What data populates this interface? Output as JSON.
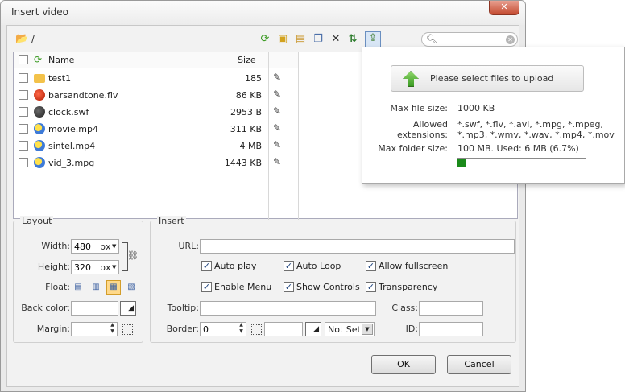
{
  "window": {
    "title": "Insert video",
    "close_label": "✕"
  },
  "toolbar": {
    "path": "/",
    "search": {
      "value": "",
      "placeholder": ""
    }
  },
  "files": {
    "header": {
      "name": "Name",
      "size": "Size"
    },
    "rows": [
      {
        "name": "test1",
        "size": "185",
        "type": "folder"
      },
      {
        "name": "barsandtone.flv",
        "size": "86 KB",
        "type": "flv"
      },
      {
        "name": "clock.swf",
        "size": "2953 B",
        "type": "swf"
      },
      {
        "name": "movie.mp4",
        "size": "311 KB",
        "type": "mp4"
      },
      {
        "name": "sintel.mp4",
        "size": "4 MB",
        "type": "mp4"
      },
      {
        "name": "vid_3.mpg",
        "size": "1443 KB",
        "type": "mpg"
      }
    ]
  },
  "layout": {
    "legend": "Layout",
    "width_label": "Width:",
    "width_value": "480",
    "width_unit": "px",
    "height_label": "Height:",
    "height_value": "320",
    "height_unit": "px",
    "float_label": "Float:",
    "backcolor_label": "Back color:",
    "backcolor_value": "",
    "margin_label": "Margin:",
    "margin_value": ""
  },
  "insert": {
    "legend": "Insert",
    "url_label": "URL:",
    "url_value": "",
    "checkboxes": {
      "auto_play": "Auto play",
      "auto_loop": "Auto Loop",
      "allow_fullscreen": "Allow fullscreen",
      "enable_menu": "Enable Menu",
      "show_controls": "Show Controls",
      "transparency": "Transparency"
    },
    "tooltip_label": "Tooltip:",
    "tooltip_value": "",
    "class_label": "Class:",
    "class_value": "",
    "border_label": "Border:",
    "border_value": "0",
    "border_color": "",
    "border_style": "Not Set",
    "id_label": "ID:",
    "id_value": ""
  },
  "buttons": {
    "ok": "OK",
    "cancel": "Cancel"
  },
  "upload": {
    "button_label": "Please select files to upload",
    "max_file_label": "Max file size:",
    "max_file_value": "1000 KB",
    "ext_label": "Allowed extensions:",
    "ext_line1": "*.swf, *.flv, *.avi, *.mpg, *.mpeg,",
    "ext_line2": "*.mp3, *.wmv, *.wav, *.mp4, *.mov",
    "folder_label": "Max folder size:",
    "folder_value": "100 MB. Used: 6 MB (6.7%)",
    "used_fraction": 0.067,
    "progress_color": "#1a8a1a"
  }
}
